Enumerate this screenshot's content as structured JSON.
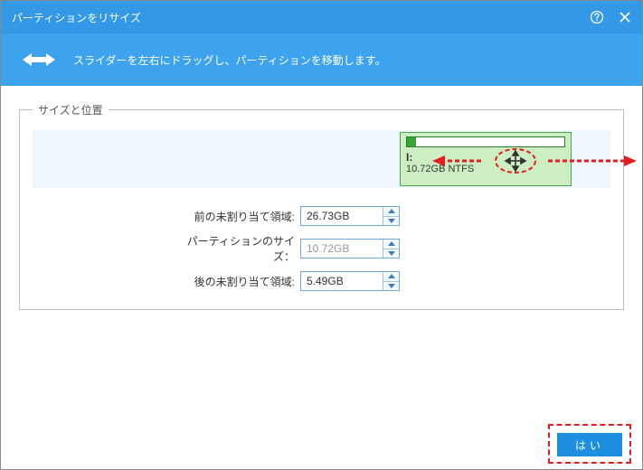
{
  "window": {
    "title": "パーティションをリサイズ"
  },
  "banner": {
    "instruction": "スライダーを左右にドラッグし、パーティションを移動します。"
  },
  "group": {
    "legend": "サイズと位置"
  },
  "partition": {
    "drive_letter": "I:",
    "size_label": "10.72GB NTFS"
  },
  "fields": {
    "before_unallocated": {
      "label": "前の未割り当て領域:",
      "value": "26.73GB"
    },
    "partition_size": {
      "label": "パーティションのサイズ：",
      "value": "10.72GB"
    },
    "after_unallocated": {
      "label": "後の未割り当て領域:",
      "value": "5.49GB"
    }
  },
  "buttons": {
    "ok": "はい"
  },
  "colors": {
    "header_blue": "#3399e6",
    "banner_blue": "#3ea3ee",
    "partition_green": "#cdeec2",
    "annotation_red": "#e02020"
  }
}
